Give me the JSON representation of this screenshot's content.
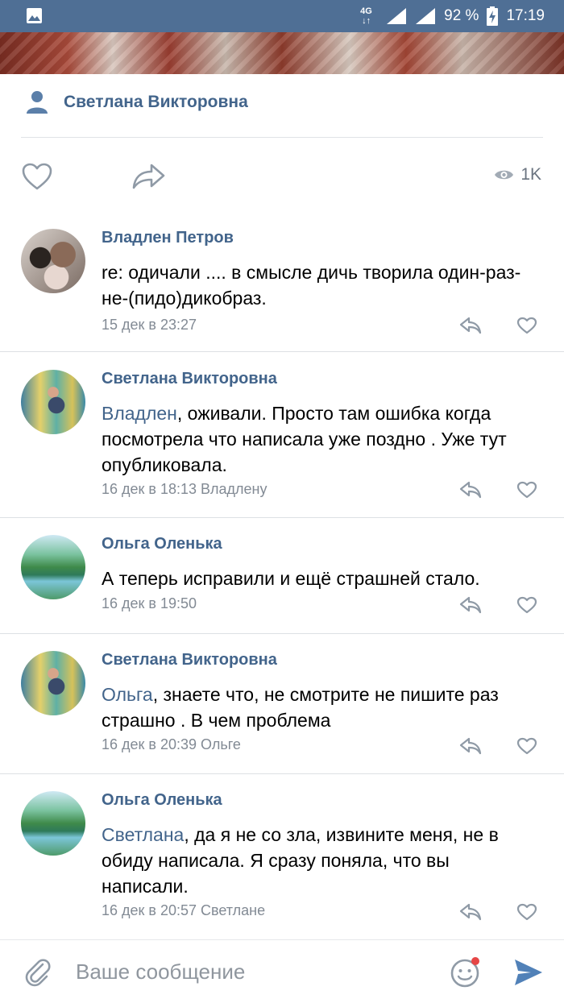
{
  "status_bar": {
    "network": "4G",
    "battery": "92 %",
    "time": "17:19"
  },
  "post": {
    "author": "Светлана Викторовна",
    "views": "1K"
  },
  "comments": [
    {
      "name": "Владлен Петров",
      "mention": "",
      "text": "re: одичали .... в смысле дичь творила один-раз-не-(пидо)дикобраз.",
      "meta": "15 дек в 23:27"
    },
    {
      "name": "Светлана Викторовна",
      "mention": "Владлен",
      "text": ", оживали. Просто там ошибка когда посмотрела что написала уже поздно . Уже тут опубликовала.",
      "meta": "16 дек в 18:13 Владлену"
    },
    {
      "name": "Ольга Оленька",
      "mention": "",
      "text": "А теперь исправили и ещё страшней стало.",
      "meta": "16 дек в 19:50"
    },
    {
      "name": "Светлана Викторовна",
      "mention": "Ольга",
      "text": ", знаете что, не смотрите не пишите раз страшно . В чем проблема",
      "meta": "16 дек в 20:39 Ольге"
    },
    {
      "name": "Ольга Оленька",
      "mention": "Светлана",
      "text": ", да я не со зла, извините меня, не в обиду написала. Я сразу поняла, что вы написали.",
      "meta": "16 дек в 20:57 Светлане"
    }
  ],
  "input": {
    "placeholder": "Ваше сообщение"
  },
  "colors": {
    "status_bar": "#4f6f95",
    "link": "#42648b",
    "accent": "#5181b8",
    "badge": "#e64646"
  }
}
